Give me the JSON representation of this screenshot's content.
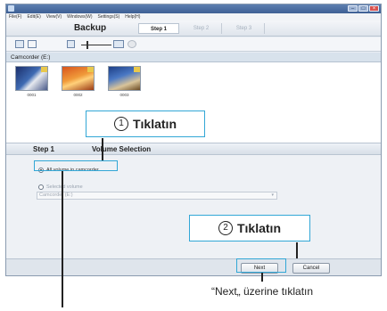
{
  "window": {
    "title": "",
    "controls": [
      "–",
      "□",
      "×"
    ]
  },
  "menu": {
    "items": [
      "File(F)",
      "Edit(E)",
      "View(V)",
      "Windows(W)",
      "Settings(S)",
      "Help(H)"
    ]
  },
  "header": {
    "title": "Backup",
    "steps": [
      "Step 1",
      "Step 2",
      "Step 3"
    ]
  },
  "source": {
    "label": "Camcorder (E:)"
  },
  "thumbnails": [
    {
      "caption": "0001"
    },
    {
      "caption": "0002"
    },
    {
      "caption": "0003"
    }
  ],
  "step_strip": {
    "step": "Step 1",
    "title": "Volume Selection"
  },
  "options": {
    "all": "All volume in camcorder",
    "selected": "Selected volume",
    "dropdown_value": "Camcorder (E:)"
  },
  "buttons": {
    "next": "Next",
    "cancel": "Cancel"
  },
  "annotations": {
    "callout1_num": "1",
    "callout1_text": "Tıklatın",
    "callout2_num": "2",
    "callout2_text": "Tıklatın",
    "caption": "“Next„ üzerine tıklatın"
  }
}
